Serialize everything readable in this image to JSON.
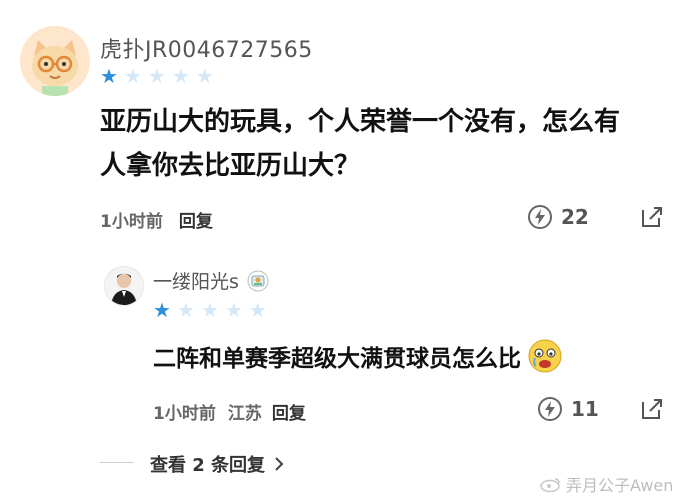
{
  "comment1": {
    "username": "虎扑JR0046727565",
    "rating": 1,
    "rating_max": 5,
    "text_line1": "亚历山大的玩具，个人荣誉一个没有，怎么有",
    "text_line2": "人拿你去比亚历山大？",
    "time": "1小时前",
    "reply_label": "回复",
    "likes": "22"
  },
  "comment2": {
    "username": "一缕阳光s",
    "rating": 1,
    "rating_max": 5,
    "text": "二阵和单赛季超级大满贯球员怎么比",
    "time": "1小时前",
    "location": "江苏",
    "reply_label": "回复",
    "likes": "11"
  },
  "more_replies": "查看 2 条回复",
  "watermark": "弄月公子Awen",
  "colors": {
    "star_on": "#2b8fd9",
    "star_off": "#d4e8f8"
  },
  "icons": [
    "avatar-cat-glasses",
    "badge-icon",
    "lightning-like-icon",
    "share-icon",
    "chevron-right-icon",
    "emoji-cry-icon"
  ]
}
